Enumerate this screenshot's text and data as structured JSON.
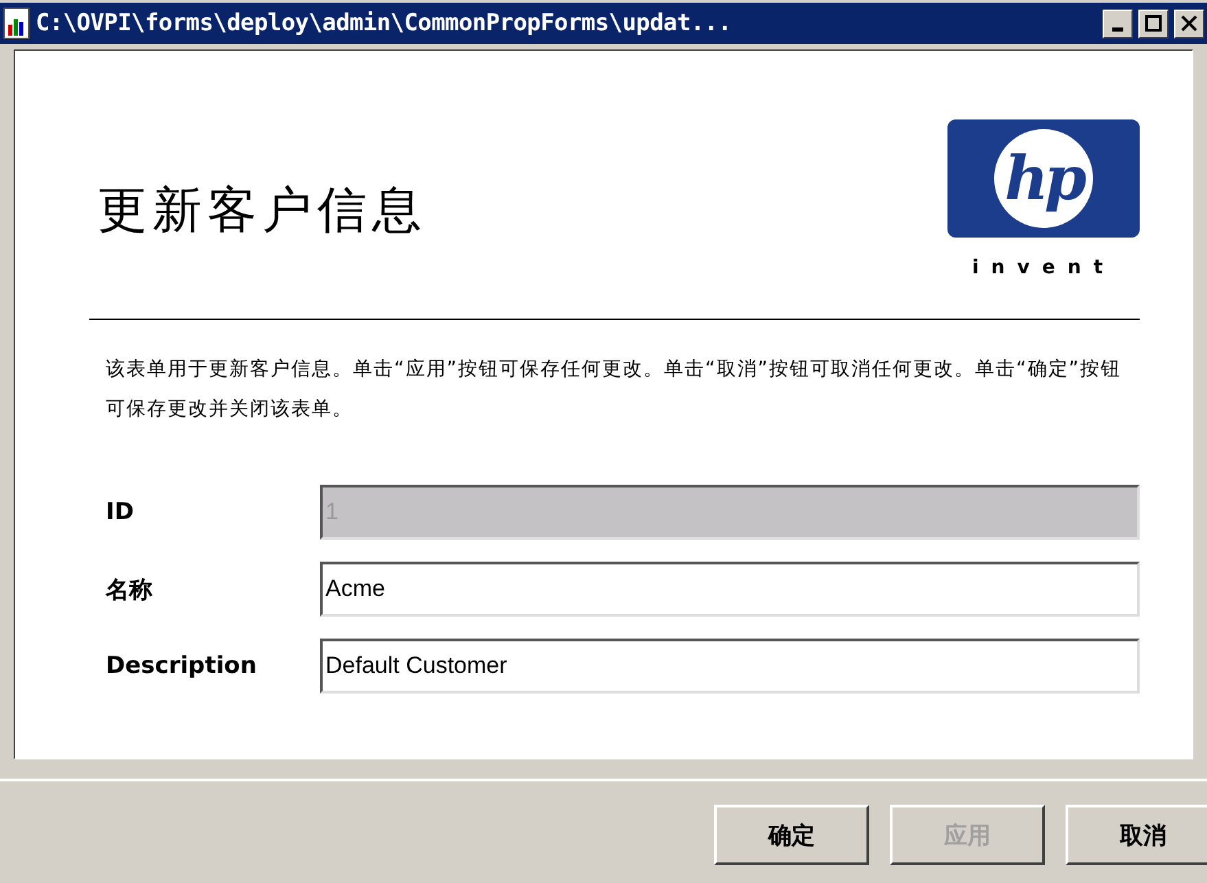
{
  "window": {
    "title": "C:\\OVPI\\forms\\deploy\\admin\\CommonPropForms\\updat..."
  },
  "header": {
    "title": "更新客户信息",
    "logo": {
      "mark": "hp",
      "tagline": "invent"
    }
  },
  "description": "该表单用于更新客户信息。单击“应用”按钮可保存任何更改。单击“取消”按钮可取消任何更改。单击“确定”按钮可保存更改并关闭该表单。",
  "fields": [
    {
      "label": "ID",
      "value": "1",
      "disabled": true
    },
    {
      "label": "名称",
      "value": "Acme",
      "disabled": false
    },
    {
      "label": "Description",
      "value": "Default Customer",
      "disabled": false
    }
  ],
  "buttons": [
    {
      "label": "确定",
      "disabled": false
    },
    {
      "label": "应用",
      "disabled": true
    },
    {
      "label": "取消",
      "disabled": false
    }
  ]
}
